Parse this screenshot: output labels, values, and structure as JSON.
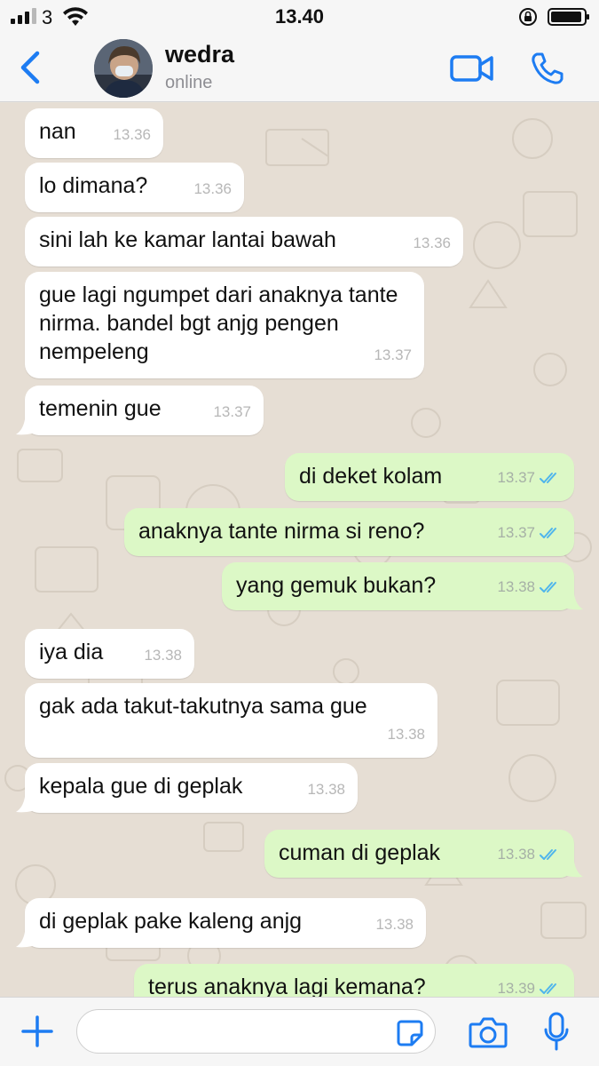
{
  "status_bar": {
    "carrier": "3",
    "time": "13.40"
  },
  "header": {
    "contact_name": "wedra",
    "presence": "online"
  },
  "messages": [
    {
      "dir": "in",
      "text": "nan",
      "time": "13.36"
    },
    {
      "dir": "in",
      "text": "lo dimana?",
      "time": "13.36"
    },
    {
      "dir": "in",
      "text": "sini lah ke kamar lantai bawah",
      "time": "13.36"
    },
    {
      "dir": "in",
      "text": "gue lagi ngumpet dari anaknya tante nirma. bandel bgt anjg pengen nempeleng",
      "line1": "gue lagi ngumpet dari anaknya",
      "line2": "tante nirma. bandel bgt anjg",
      "line3": "pengen nempeleng",
      "time": "13.37"
    },
    {
      "dir": "in",
      "text": "temenin gue",
      "time": "13.37"
    },
    {
      "dir": "out",
      "text": "di deket kolam",
      "time": "13.37",
      "read": true
    },
    {
      "dir": "out",
      "text": "anaknya tante nirma si reno?",
      "time": "13.37",
      "read": true
    },
    {
      "dir": "out",
      "text": "yang gemuk bukan?",
      "time": "13.38",
      "read": true
    },
    {
      "dir": "in",
      "text": "iya dia",
      "time": "13.38"
    },
    {
      "dir": "in",
      "text": "gak ada takut-takutnya sama gue",
      "time": "13.38"
    },
    {
      "dir": "in",
      "text": "kepala gue di geplak",
      "time": "13.38"
    },
    {
      "dir": "out",
      "text": "cuman di geplak",
      "time": "13.38",
      "read": true
    },
    {
      "dir": "in",
      "text": "di geplak pake kaleng anjg",
      "time": "13.38"
    },
    {
      "dir": "out",
      "text": "terus anaknya lagi kemana?",
      "time": "13.39",
      "read": true
    }
  ],
  "input": {
    "placeholder": ""
  },
  "colors": {
    "accent": "#1d7cf2",
    "incoming_bubble": "#ffffff",
    "outgoing_bubble": "#dcf8c6",
    "read_ticks": "#4fb5ec",
    "chat_background": "#e6ded4"
  },
  "icons": {
    "back": "chevron-left-icon",
    "video": "video-camera-icon",
    "call": "phone-icon",
    "add": "plus-icon",
    "sticker": "sticker-icon",
    "camera": "camera-icon",
    "mic": "microphone-icon"
  }
}
